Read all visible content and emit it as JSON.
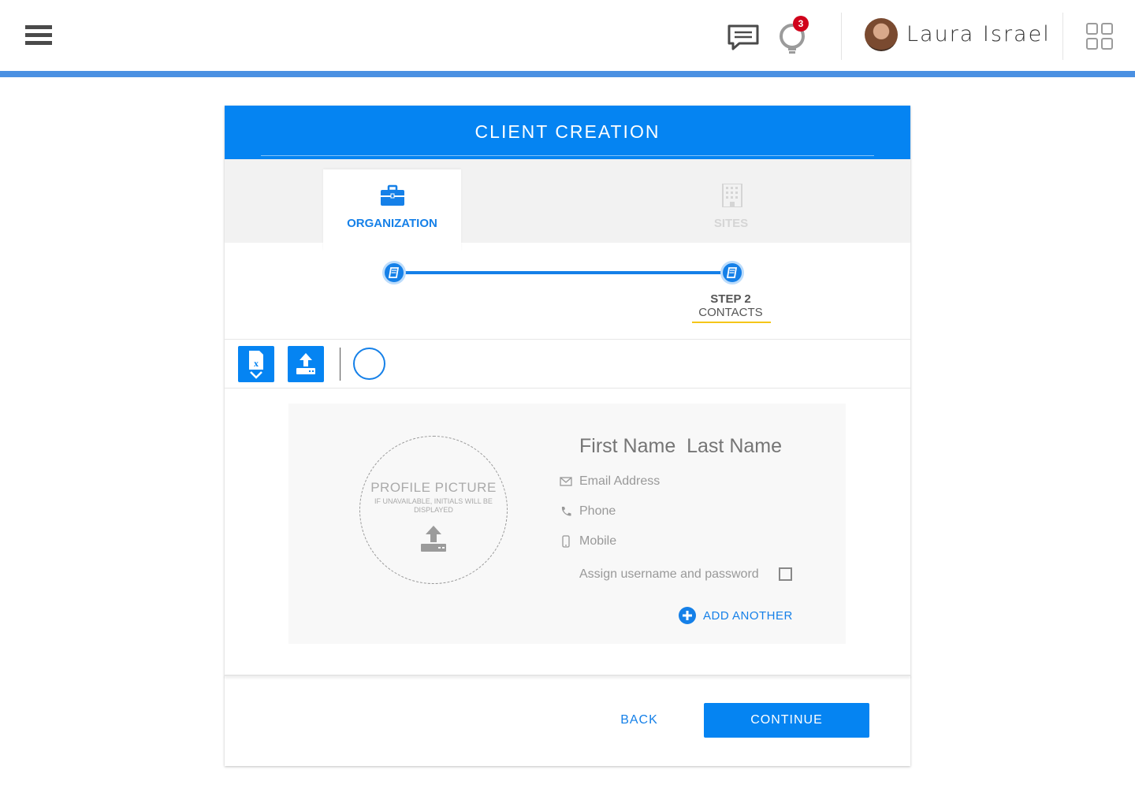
{
  "topbar": {
    "menu_icon": "hamburger-icon",
    "chat_icon": "chat-icon",
    "notification_icon": "lightbulb-icon",
    "notification_count": "3",
    "user_name": "Laura Israel",
    "apps_icon": "grid-icon"
  },
  "card": {
    "title": "CLIENT CREATION",
    "tabs": [
      {
        "label": "ORGANIZATION",
        "icon": "briefcase-icon",
        "active": true
      },
      {
        "label": "SITES",
        "icon": "building-icon",
        "active": false
      }
    ],
    "stepper": {
      "step_number": "STEP 2",
      "step_name": "CONTACTS"
    },
    "toolbar": {
      "export_icon": "excel-download-icon",
      "upload_icon": "upload-icon",
      "circle_icon": "circle-icon"
    },
    "contact": {
      "profile_title": "PROFILE PICTURE",
      "profile_subtitle": "IF UNAVAILABLE, INITIALS WILL BE DISPLAYED",
      "name_placeholder": "First Name  Last Name",
      "email_placeholder": "Email Address",
      "phone_placeholder": "Phone",
      "mobile_placeholder": "Mobile",
      "assign_label": "Assign username and password",
      "add_another_label": "ADD ANOTHER"
    },
    "footer": {
      "back_label": "BACK",
      "continue_label": "CONTINUE"
    }
  },
  "colors": {
    "primary": "#0584f2",
    "accent_bar": "#4a90e2",
    "badge": "#d0021b",
    "step_underline": "#f5c518"
  }
}
